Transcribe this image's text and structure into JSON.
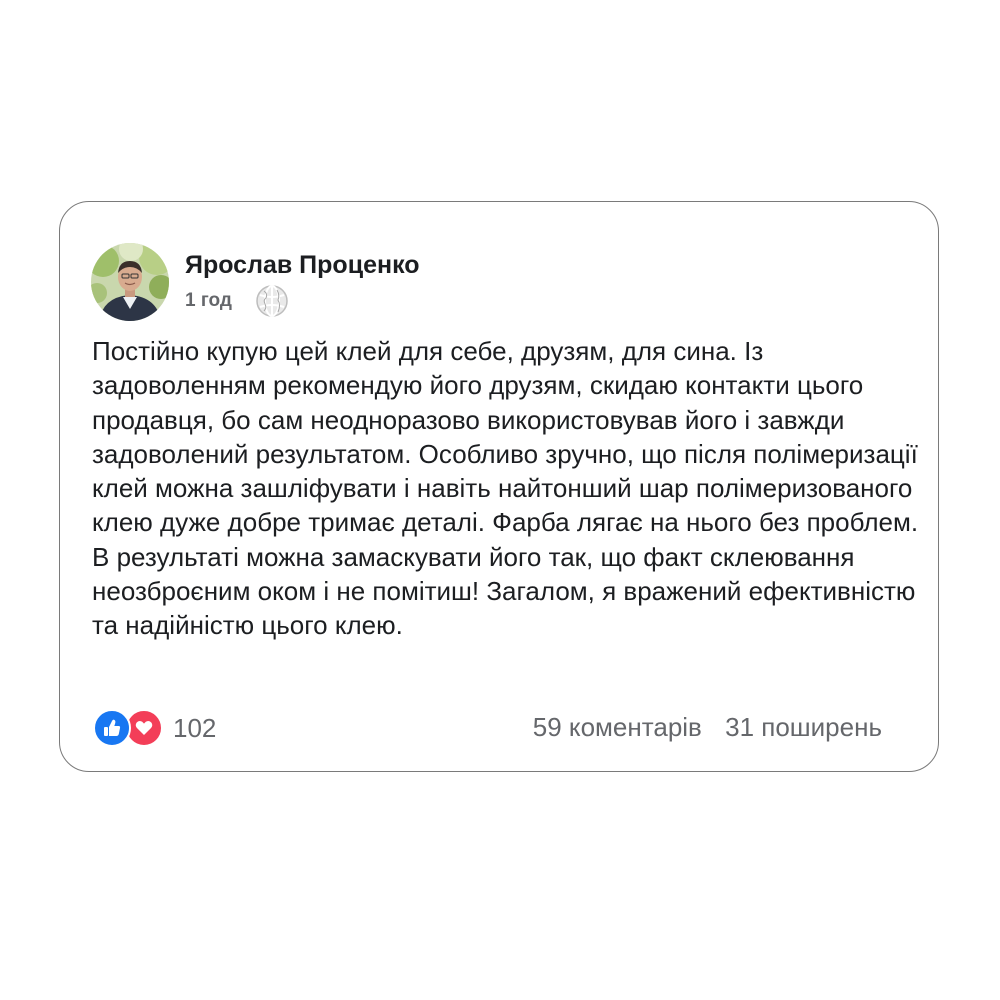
{
  "post": {
    "author": "Ярослав Проценко",
    "time": "1 год",
    "audience_icon": "globe-icon",
    "text": "Постійно купую цей клей для себе, друзям, для сина. Із задоволенням рекомендую його друзям, скидаю контакти цього продавця, бо сам неодноразово використовував його і завжди задоволений результатом. Особливо зручно, що після полімеризації клей можна зашліфувати і навіть найтонший шар полімеризованого клею дуже добре тримає деталі. Фарба лягає на нього без проблем. В результаті можна замаскувати його так, що факт склеювання неозброєним оком і не помітиш! Загалом, я вражений ефективністю та надійністю цього клею."
  },
  "reactions": {
    "icons": [
      "like-icon",
      "love-icon"
    ],
    "count": "102"
  },
  "stats": {
    "comments": "59 коментарів",
    "shares": "31 поширень"
  },
  "colors": {
    "like": "#1877f2",
    "love": "#f33e58",
    "secondary_text": "#65676b",
    "border": "#7a7a7a"
  }
}
